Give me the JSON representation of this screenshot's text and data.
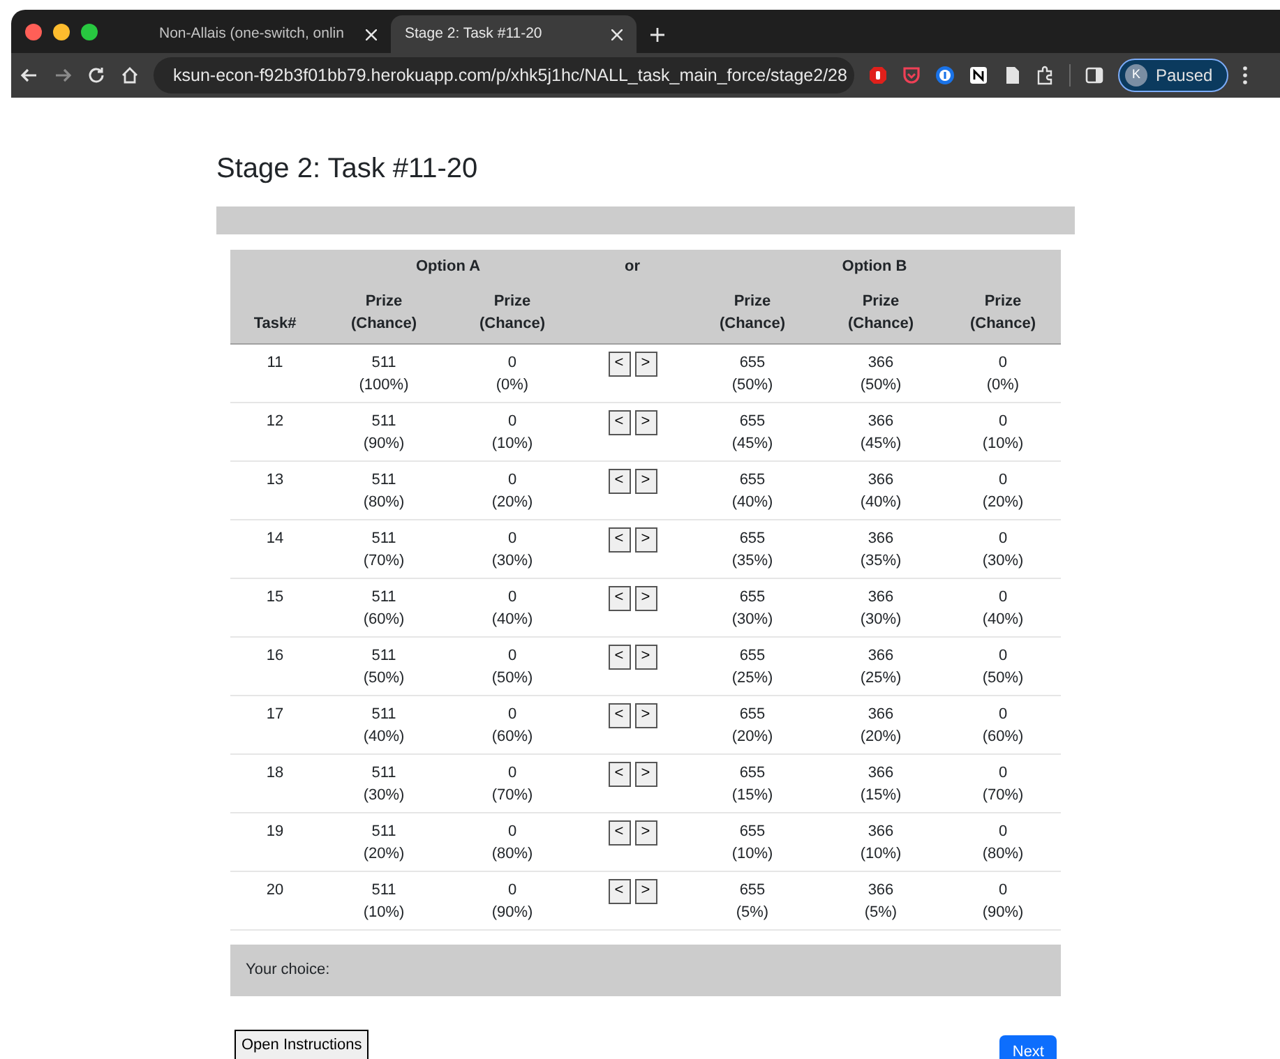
{
  "browser": {
    "tabs": [
      {
        "title": "Non-Allais (one-switch, onlin",
        "selected": false
      },
      {
        "title": "Stage 2: Task #11-20",
        "selected": true
      }
    ],
    "url": "ksun-econ-f92b3f01bb79.herokuapp.com/p/xhk5j1hc/NALL_task_main_force/stage2/28",
    "profile": {
      "initial": "K",
      "label": "Paused"
    }
  },
  "page_title": "Stage 2: Task #11-20",
  "table": {
    "group_headers": {
      "option_a": "Option A",
      "middle": "or",
      "option_b": "Option B"
    },
    "columns": [
      {
        "line2": "Task#"
      },
      {
        "line1": "Prize",
        "line2": "(Chance)"
      },
      {
        "line1": "Prize",
        "line2": "(Chance)"
      },
      {},
      {
        "line1": "Prize",
        "line2": "(Chance)"
      },
      {
        "line1": "Prize",
        "line2": "(Chance)"
      },
      {
        "line1": "Prize",
        "line2": "(Chance)"
      }
    ],
    "rows": [
      {
        "task": "11",
        "a": [
          [
            "511",
            "(100%)"
          ],
          [
            "0",
            "(0%)"
          ]
        ],
        "buttons": [
          "<",
          ">"
        ],
        "b": [
          [
            "655",
            "(50%)"
          ],
          [
            "366",
            "(50%)"
          ],
          [
            "0",
            "(0%)"
          ]
        ]
      },
      {
        "task": "12",
        "a": [
          [
            "511",
            "(90%)"
          ],
          [
            "0",
            "(10%)"
          ]
        ],
        "buttons": [
          "<",
          ">"
        ],
        "b": [
          [
            "655",
            "(45%)"
          ],
          [
            "366",
            "(45%)"
          ],
          [
            "0",
            "(10%)"
          ]
        ]
      },
      {
        "task": "13",
        "a": [
          [
            "511",
            "(80%)"
          ],
          [
            "0",
            "(20%)"
          ]
        ],
        "buttons": [
          "<",
          ">"
        ],
        "b": [
          [
            "655",
            "(40%)"
          ],
          [
            "366",
            "(40%)"
          ],
          [
            "0",
            "(20%)"
          ]
        ]
      },
      {
        "task": "14",
        "a": [
          [
            "511",
            "(70%)"
          ],
          [
            "0",
            "(30%)"
          ]
        ],
        "buttons": [
          "<",
          ">"
        ],
        "b": [
          [
            "655",
            "(35%)"
          ],
          [
            "366",
            "(35%)"
          ],
          [
            "0",
            "(30%)"
          ]
        ]
      },
      {
        "task": "15",
        "a": [
          [
            "511",
            "(60%)"
          ],
          [
            "0",
            "(40%)"
          ]
        ],
        "buttons": [
          "<",
          ">"
        ],
        "b": [
          [
            "655",
            "(30%)"
          ],
          [
            "366",
            "(30%)"
          ],
          [
            "0",
            "(40%)"
          ]
        ]
      },
      {
        "task": "16",
        "a": [
          [
            "511",
            "(50%)"
          ],
          [
            "0",
            "(50%)"
          ]
        ],
        "buttons": [
          "<",
          ">"
        ],
        "b": [
          [
            "655",
            "(25%)"
          ],
          [
            "366",
            "(25%)"
          ],
          [
            "0",
            "(50%)"
          ]
        ]
      },
      {
        "task": "17",
        "a": [
          [
            "511",
            "(40%)"
          ],
          [
            "0",
            "(60%)"
          ]
        ],
        "buttons": [
          "<",
          ">"
        ],
        "b": [
          [
            "655",
            "(20%)"
          ],
          [
            "366",
            "(20%)"
          ],
          [
            "0",
            "(60%)"
          ]
        ]
      },
      {
        "task": "18",
        "a": [
          [
            "511",
            "(30%)"
          ],
          [
            "0",
            "(70%)"
          ]
        ],
        "buttons": [
          "<",
          ">"
        ],
        "b": [
          [
            "655",
            "(15%)"
          ],
          [
            "366",
            "(15%)"
          ],
          [
            "0",
            "(70%)"
          ]
        ]
      },
      {
        "task": "19",
        "a": [
          [
            "511",
            "(20%)"
          ],
          [
            "0",
            "(80%)"
          ]
        ],
        "buttons": [
          "<",
          ">"
        ],
        "b": [
          [
            "655",
            "(10%)"
          ],
          [
            "366",
            "(10%)"
          ],
          [
            "0",
            "(80%)"
          ]
        ]
      },
      {
        "task": "20",
        "a": [
          [
            "511",
            "(10%)"
          ],
          [
            "0",
            "(90%)"
          ]
        ],
        "buttons": [
          "<",
          ">"
        ],
        "b": [
          [
            "655",
            "(5%)"
          ],
          [
            "366",
            "(5%)"
          ],
          [
            "0",
            "(90%)"
          ]
        ]
      }
    ]
  },
  "choice_label": "Your choice:",
  "instructions_button": "Open Instructions",
  "next_button": "Next"
}
